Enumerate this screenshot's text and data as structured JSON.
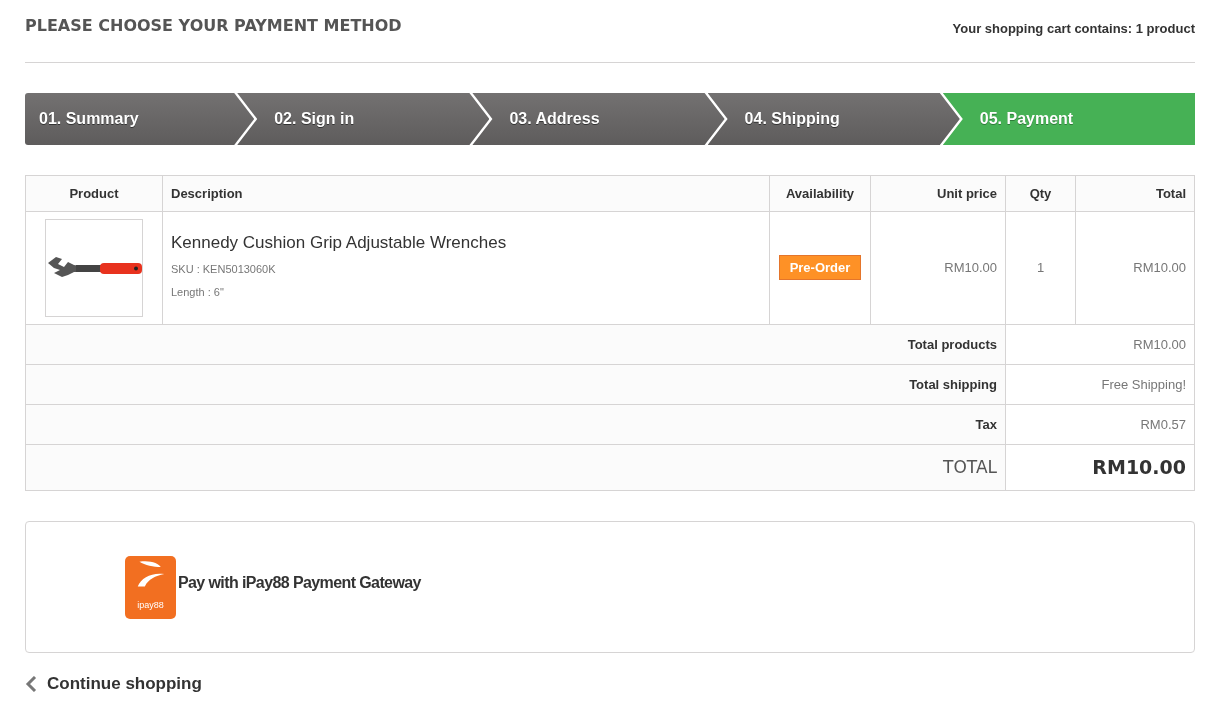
{
  "page_title": "PLEASE CHOOSE YOUR PAYMENT METHOD",
  "cart_summary": "Your shopping cart contains: 1 product",
  "steps": [
    {
      "label": "01. Summary",
      "selected": false
    },
    {
      "label": "02. Sign in",
      "selected": false
    },
    {
      "label": "03. Address",
      "selected": false
    },
    {
      "label": "04. Shipping",
      "selected": false
    },
    {
      "label": "05. Payment",
      "selected": true
    }
  ],
  "table": {
    "columns": [
      "Product",
      "Description",
      "Availability",
      "Unit price",
      "Qty",
      "Total"
    ],
    "rows": [
      {
        "name": "Kennedy Cushion Grip Adjustable Wrenches",
        "sku": "SKU : KEN5013060K",
        "attribute": "Length : 6\"",
        "availability": "Pre-Order",
        "unit_price": "RM10.00",
        "qty": "1",
        "total": "RM10.00"
      }
    ],
    "summary": [
      {
        "kind": "line",
        "label": "Total products",
        "value": "RM10.00"
      },
      {
        "kind": "line",
        "label": "Total shipping",
        "value": "Free Shipping!"
      },
      {
        "kind": "line",
        "label": "Tax",
        "value": "RM0.57"
      },
      {
        "kind": "grand",
        "label": "TOTAL",
        "value": "RM10.00"
      }
    ]
  },
  "payment_option": {
    "logo_text": "ipay88",
    "label": "Pay with iPay88 Payment Gateway"
  },
  "continue_link": "Continue shopping"
}
